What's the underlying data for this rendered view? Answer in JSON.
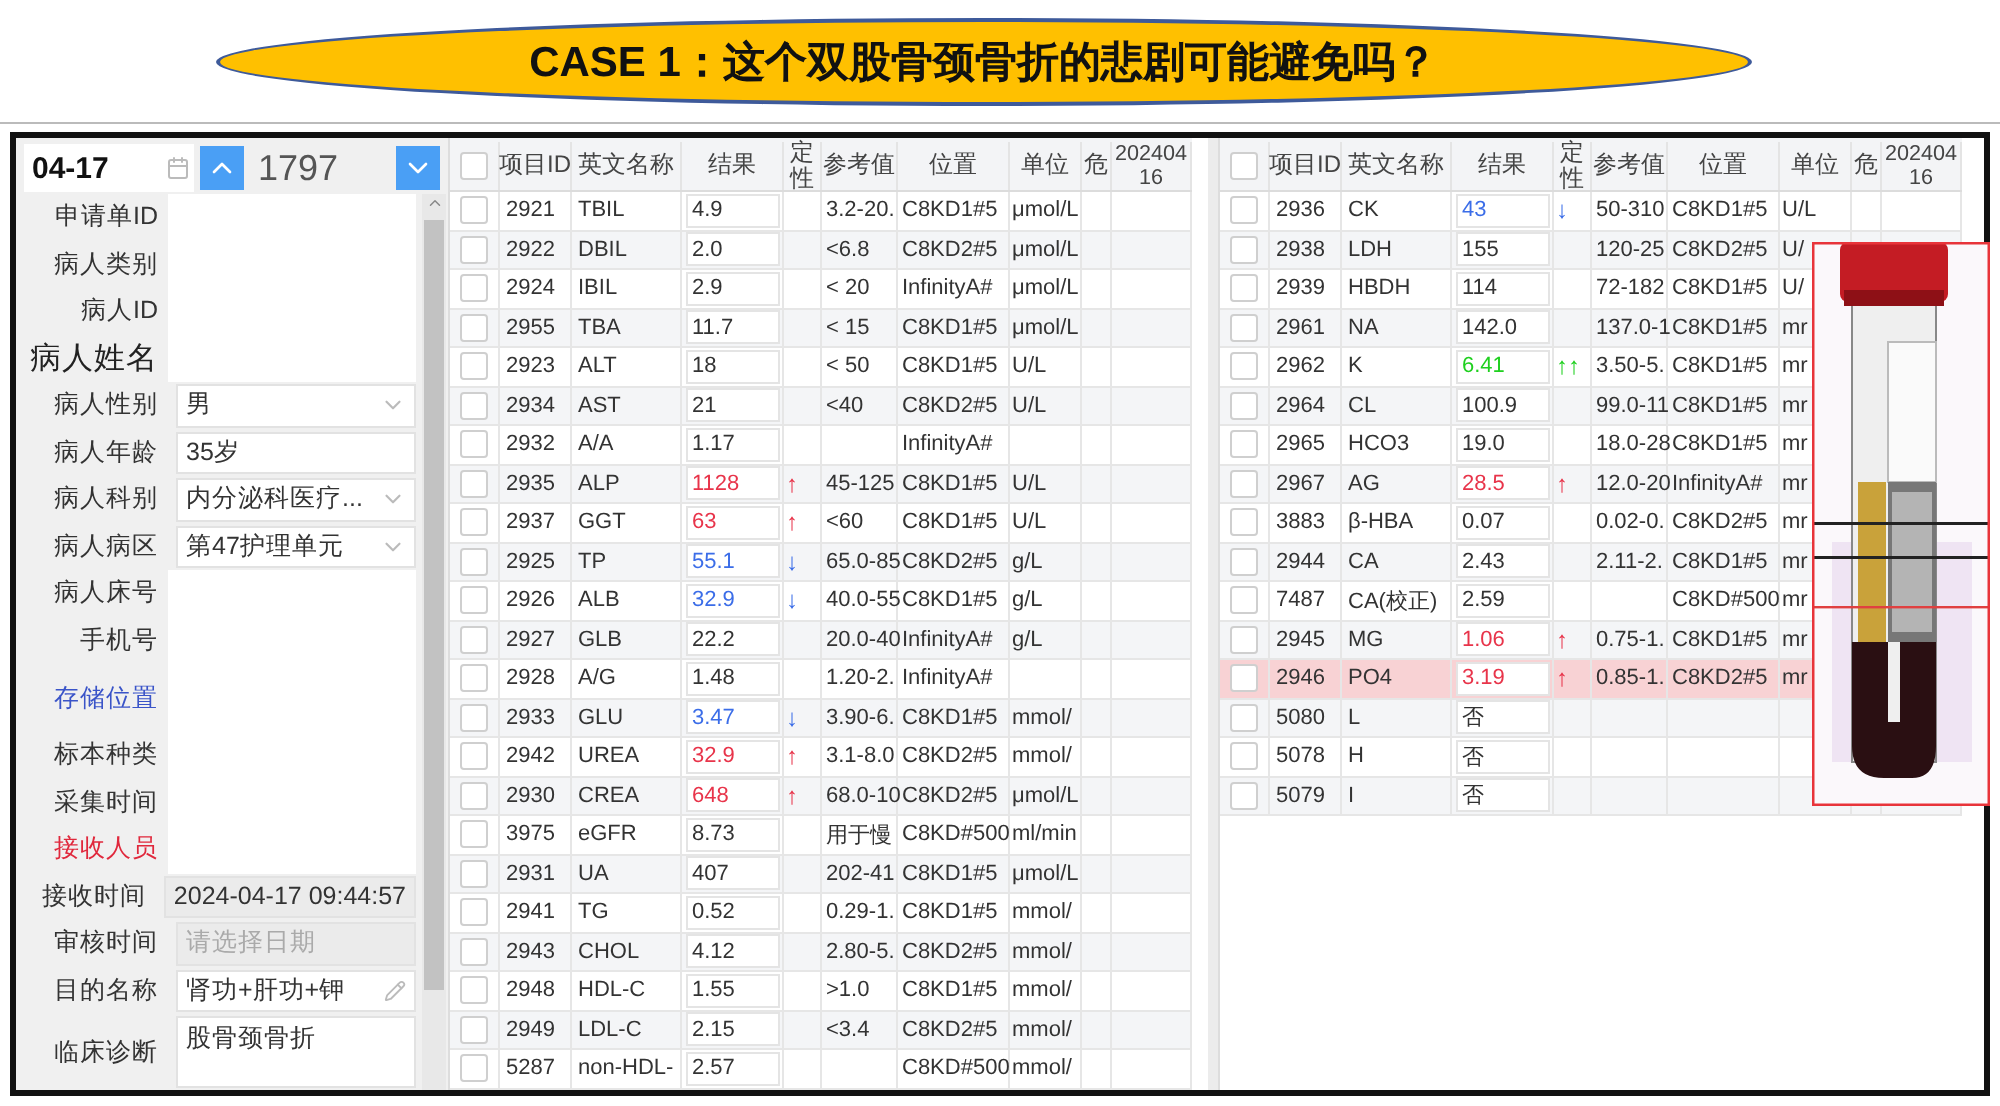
{
  "banner": {
    "title": "CASE 1：这个双股骨颈骨折的悲剧可能避免吗？"
  },
  "top_bar": {
    "date": "04-17",
    "number": "1797"
  },
  "form": [
    {
      "label": "申请单ID",
      "kind": "plain",
      "field": {
        "kind": "blank"
      }
    },
    {
      "label": "病人类别",
      "kind": "plain",
      "field": {
        "kind": "blank"
      }
    },
    {
      "label": "病人ID",
      "kind": "plain",
      "field": {
        "kind": "blank"
      }
    },
    {
      "label": "病人姓名",
      "kind": "title",
      "field": {
        "kind": "blank"
      }
    },
    {
      "label": "病人性别",
      "kind": "plain",
      "field": {
        "kind": "select",
        "value": "男"
      }
    },
    {
      "label": "病人年龄",
      "kind": "plain",
      "field": {
        "kind": "text",
        "value": "35岁"
      }
    },
    {
      "label": "病人科别",
      "kind": "plain",
      "field": {
        "kind": "select",
        "value": "内分泌科医疗..."
      }
    },
    {
      "label": "病人病区",
      "kind": "plain",
      "field": {
        "kind": "select",
        "value": "第47护理单元"
      }
    },
    {
      "label": "病人床号",
      "kind": "plain",
      "field": {
        "kind": "blank"
      }
    },
    {
      "label": "手机号",
      "kind": "plain",
      "field": {
        "kind": "blank"
      }
    },
    {
      "label": "存储位置",
      "kind": "link",
      "field": {
        "kind": "blank"
      }
    },
    {
      "label": "标本种类",
      "kind": "plain",
      "field": {
        "kind": "blank"
      }
    },
    {
      "label": "采集时间",
      "kind": "plain",
      "field": {
        "kind": "blank"
      }
    },
    {
      "label": "接收人员",
      "kind": "required",
      "field": {
        "kind": "blank"
      }
    },
    {
      "label": "接收时间",
      "kind": "plain",
      "field": {
        "kind": "readonly",
        "value": "2024-04-17 09:44:57"
      }
    },
    {
      "label": "审核时间",
      "kind": "plain",
      "field": {
        "kind": "date",
        "placeholder": "请选择日期"
      }
    },
    {
      "label": "目的名称",
      "kind": "plain",
      "field": {
        "kind": "edit",
        "value": "肾功+肝功+钾"
      }
    },
    {
      "label": "临床诊断",
      "kind": "plain",
      "field": {
        "kind": "textarea",
        "value": "股骨颈骨折"
      }
    }
  ],
  "tables": [
    {
      "header_checked": false,
      "columns": [
        "项目ID",
        "英文名称",
        "结果",
        "定性",
        "参考值",
        "位置",
        "单位",
        "危",
        "20240416"
      ],
      "rows": [
        {
          "checked": false,
          "selected": false,
          "id": "2921",
          "name": "TBIL",
          "result": "4.9",
          "kind": "normal",
          "ref": "3.2-20.",
          "position": "C8KD1#5",
          "unit": "μmol/L"
        },
        {
          "checked": false,
          "selected": false,
          "id": "2922",
          "name": "DBIL",
          "result": "2.0",
          "kind": "normal",
          "ref": "<6.8",
          "position": "C8KD2#5",
          "unit": "μmol/L"
        },
        {
          "checked": false,
          "selected": false,
          "id": "2924",
          "name": "IBIL",
          "result": "2.9",
          "kind": "normal",
          "ref": "< 20",
          "position": "InfinityA#",
          "unit": "μmol/L"
        },
        {
          "checked": false,
          "selected": false,
          "id": "2955",
          "name": "TBA",
          "result": "11.7",
          "kind": "normal",
          "ref": "< 15",
          "position": "C8KD1#5",
          "unit": "μmol/L"
        },
        {
          "checked": false,
          "selected": false,
          "id": "2923",
          "name": "ALT",
          "result": "18",
          "kind": "normal",
          "ref": "< 50",
          "position": "C8KD1#5",
          "unit": "U/L"
        },
        {
          "checked": false,
          "selected": false,
          "id": "2934",
          "name": "AST",
          "result": "21",
          "kind": "normal",
          "ref": "<40",
          "position": "C8KD2#5",
          "unit": "U/L"
        },
        {
          "checked": false,
          "selected": false,
          "id": "2932",
          "name": "A/A",
          "result": "1.17",
          "kind": "normal",
          "position": "InfinityA#"
        },
        {
          "checked": false,
          "selected": false,
          "id": "2935",
          "name": "ALP",
          "result": "1128",
          "kind": "high",
          "arrow": "↑",
          "ref": "45-125",
          "position": "C8KD1#5",
          "unit": "U/L"
        },
        {
          "checked": false,
          "selected": false,
          "id": "2937",
          "name": "GGT",
          "result": "63",
          "kind": "high",
          "arrow": "↑",
          "ref": "<60",
          "position": "C8KD1#5",
          "unit": "U/L"
        },
        {
          "checked": false,
          "selected": false,
          "id": "2925",
          "name": "TP",
          "result": "55.1",
          "kind": "low",
          "arrow": "↓",
          "ref": "65.0-85",
          "position": "C8KD2#5",
          "unit": "g/L"
        },
        {
          "checked": false,
          "selected": false,
          "id": "2926",
          "name": "ALB",
          "result": "32.9",
          "kind": "low",
          "arrow": "↓",
          "ref": "40.0-55",
          "position": "C8KD1#5",
          "unit": "g/L"
        },
        {
          "checked": false,
          "selected": false,
          "id": "2927",
          "name": "GLB",
          "result": "22.2",
          "kind": "normal",
          "ref": "20.0-40",
          "position": "InfinityA#",
          "unit": "g/L"
        },
        {
          "checked": false,
          "selected": false,
          "id": "2928",
          "name": "A/G",
          "result": "1.48",
          "kind": "normal",
          "ref": "1.20-2.",
          "position": "InfinityA#"
        },
        {
          "checked": false,
          "selected": false,
          "id": "2933",
          "name": "GLU",
          "result": "3.47",
          "kind": "low",
          "arrow": "↓",
          "ref": "3.90-6.",
          "position": "C8KD1#5",
          "unit": "mmol/"
        },
        {
          "checked": false,
          "selected": false,
          "id": "2942",
          "name": "UREA",
          "result": "32.9",
          "kind": "high",
          "arrow": "↑",
          "ref": "3.1-8.0",
          "position": "C8KD2#5",
          "unit": "mmol/"
        },
        {
          "checked": false,
          "selected": false,
          "id": "2930",
          "name": "CREA",
          "result": "648",
          "kind": "high",
          "arrow": "↑",
          "ref": "68.0-10",
          "position": "C8KD2#5",
          "unit": "μmol/L"
        },
        {
          "checked": false,
          "selected": false,
          "id": "3975",
          "name": "eGFR",
          "result": "8.73",
          "kind": "normal",
          "ref": "用于慢",
          "position": "C8KD#500",
          "unit": "ml/min"
        },
        {
          "checked": false,
          "selected": false,
          "id": "2931",
          "name": "UA",
          "result": "407",
          "kind": "normal",
          "ref": "202-41",
          "position": "C8KD1#5",
          "unit": "μmol/L"
        },
        {
          "checked": false,
          "selected": false,
          "id": "2941",
          "name": "TG",
          "result": "0.52",
          "kind": "normal",
          "ref": "0.29-1.",
          "position": "C8KD1#5",
          "unit": "mmol/"
        },
        {
          "checked": false,
          "selected": false,
          "id": "2943",
          "name": "CHOL",
          "result": "4.12",
          "kind": "normal",
          "ref": "2.80-5.",
          "position": "C8KD2#5",
          "unit": "mmol/"
        },
        {
          "checked": false,
          "selected": false,
          "id": "2948",
          "name": "HDL-C",
          "result": "1.55",
          "kind": "normal",
          "ref": ">1.0",
          "position": "C8KD1#5",
          "unit": "mmol/"
        },
        {
          "checked": false,
          "selected": false,
          "id": "2949",
          "name": "LDL-C",
          "result": "2.15",
          "kind": "normal",
          "ref": "<3.4",
          "position": "C8KD2#5",
          "unit": "mmol/"
        },
        {
          "checked": false,
          "selected": false,
          "id": "5287",
          "name": "non-HDL-",
          "result": "2.57",
          "kind": "normal",
          "position": "C8KD#500",
          "unit": "mmol/"
        }
      ]
    },
    {
      "header_checked": false,
      "columns": [
        "项目ID",
        "英文名称",
        "结果",
        "定性",
        "参考值",
        "位置",
        "单位",
        "危",
        "20240416"
      ],
      "rows": [
        {
          "checked": false,
          "selected": false,
          "id": "2936",
          "name": "CK",
          "result": "43",
          "kind": "low",
          "arrow": "↓",
          "ref": "50-310",
          "position": "C8KD1#5",
          "unit": "U/L"
        },
        {
          "checked": false,
          "selected": false,
          "id": "2938",
          "name": "LDH",
          "result": "155",
          "kind": "normal",
          "ref": "120-25",
          "position": "C8KD2#5",
          "unit": "U/"
        },
        {
          "checked": false,
          "selected": false,
          "id": "2939",
          "name": "HBDH",
          "result": "114",
          "kind": "normal",
          "ref": "72-182",
          "position": "C8KD1#5",
          "unit": "U/"
        },
        {
          "checked": false,
          "selected": false,
          "id": "2961",
          "name": "NA",
          "result": "142.0",
          "kind": "normal",
          "ref": "137.0-1",
          "position": "C8KD1#5",
          "unit": "mr"
        },
        {
          "checked": false,
          "selected": false,
          "id": "2962",
          "name": "K",
          "result": "6.41",
          "kind": "critical",
          "arrow": "↑↑",
          "ref": "3.50-5.",
          "position": "C8KD1#5",
          "unit": "mr"
        },
        {
          "checked": false,
          "selected": false,
          "id": "2964",
          "name": "CL",
          "result": "100.9",
          "kind": "normal",
          "ref": "99.0-11",
          "position": "C8KD1#5",
          "unit": "mr"
        },
        {
          "checked": false,
          "selected": false,
          "id": "2965",
          "name": "HCO3",
          "result": "19.0",
          "kind": "normal",
          "ref": "18.0-28",
          "position": "C8KD1#5",
          "unit": "mr"
        },
        {
          "checked": false,
          "selected": false,
          "id": "2967",
          "name": "AG",
          "result": "28.5",
          "kind": "high",
          "arrow": "↑",
          "ref": "12.0-20",
          "position": "InfinityA#",
          "unit": "mr"
        },
        {
          "checked": false,
          "selected": false,
          "id": "3883",
          "name": "β-HBA",
          "result": "0.07",
          "kind": "normal",
          "ref": "0.02-0.",
          "position": "C8KD2#5",
          "unit": "mr"
        },
        {
          "checked": false,
          "selected": false,
          "id": "2944",
          "name": "CA",
          "result": "2.43",
          "kind": "normal",
          "ref": "2.11-2.",
          "position": "C8KD1#5",
          "unit": "mr"
        },
        {
          "checked": false,
          "selected": false,
          "id": "7487",
          "name": "CA(校正)",
          "result": "2.59",
          "kind": "normal",
          "position": "C8KD#500",
          "unit": "mr"
        },
        {
          "checked": false,
          "selected": false,
          "id": "2945",
          "name": "MG",
          "result": "1.06",
          "kind": "high",
          "arrow": "↑",
          "ref": "0.75-1.",
          "position": "C8KD1#5",
          "unit": "mr"
        },
        {
          "checked": false,
          "selected": true,
          "id": "2946",
          "name": "PO4",
          "result": "3.19",
          "kind": "high",
          "arrow": "↑",
          "ref": "0.85-1.",
          "position": "C8KD2#5",
          "unit": "mr"
        },
        {
          "checked": false,
          "selected": false,
          "id": "5080",
          "name": "L",
          "result": "否",
          "kind": "normal"
        },
        {
          "checked": false,
          "selected": false,
          "id": "5078",
          "name": "H",
          "result": "否",
          "kind": "normal"
        },
        {
          "checked": false,
          "selected": false,
          "id": "5079",
          "name": "I",
          "result": "否",
          "kind": "normal"
        }
      ]
    }
  ]
}
